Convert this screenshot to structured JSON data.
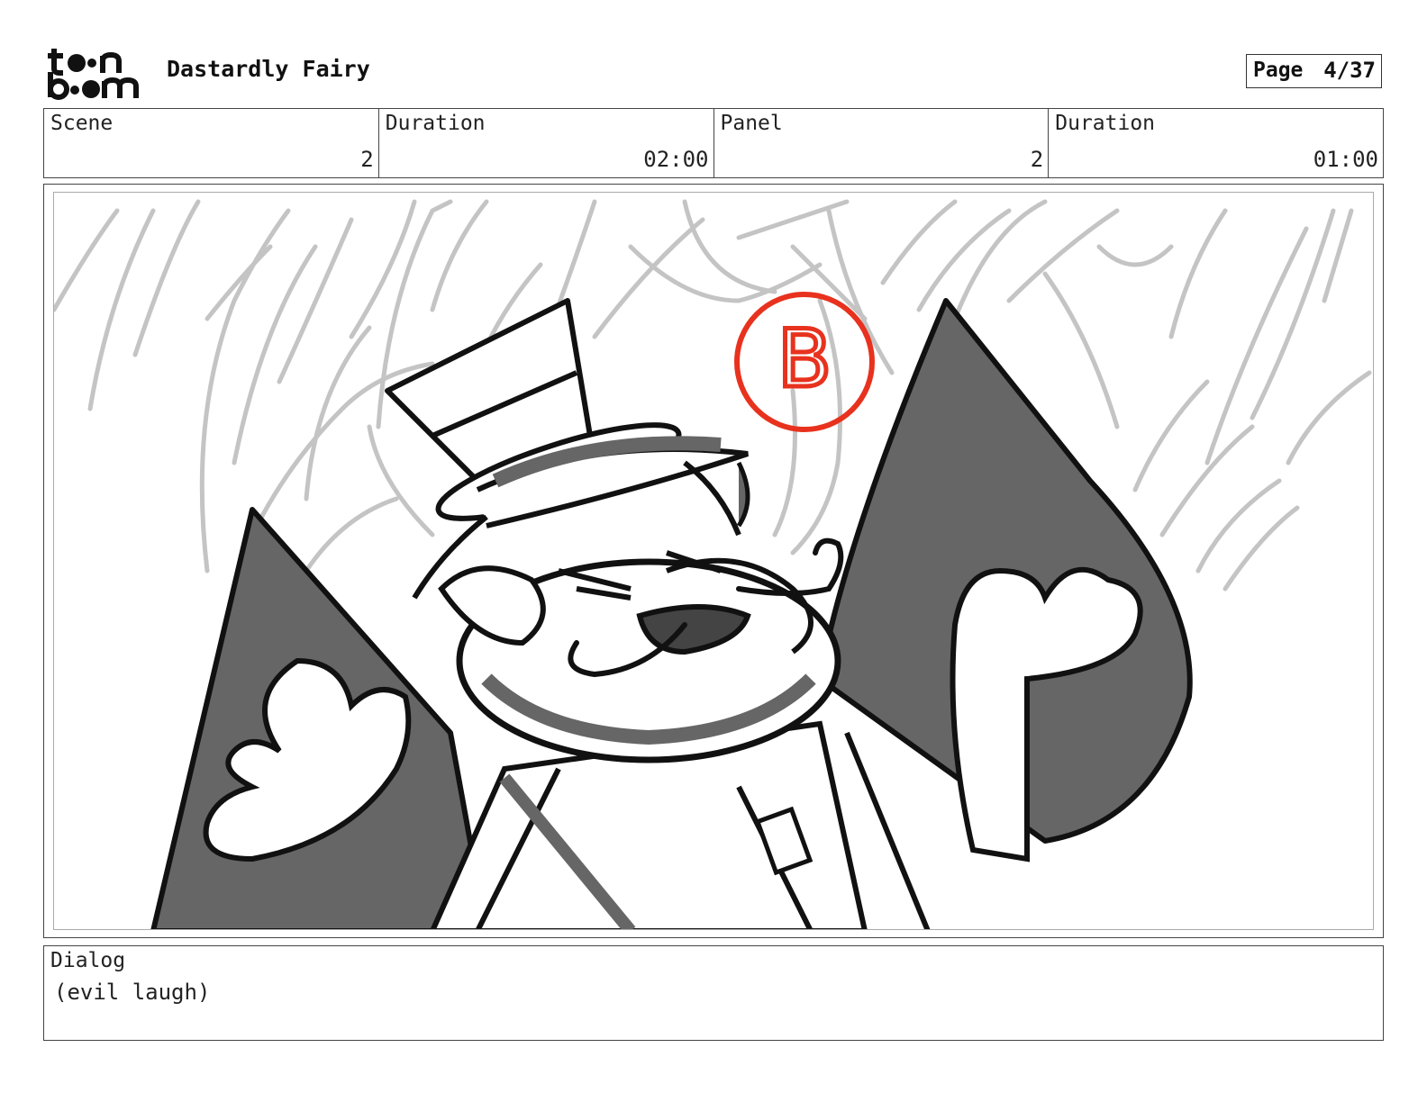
{
  "header": {
    "logo_text": "toon boom",
    "title": "Dastardly Fairy",
    "page_label": "Page",
    "page_value": "4/37"
  },
  "info": {
    "scene_label": "Scene",
    "scene_value": "2",
    "scene_duration_label": "Duration",
    "scene_duration_value": "02:00",
    "panel_label": "Panel",
    "panel_value": "2",
    "panel_duration_label": "Duration",
    "panel_duration_value": "01:00"
  },
  "panel": {
    "marker_letter": "B",
    "marker_color": "#e8321e",
    "shadow_color": "#666666",
    "background_sketch_color": "#c4c4c4"
  },
  "dialog": {
    "label": "Dialog",
    "text": "(evil laugh)"
  }
}
